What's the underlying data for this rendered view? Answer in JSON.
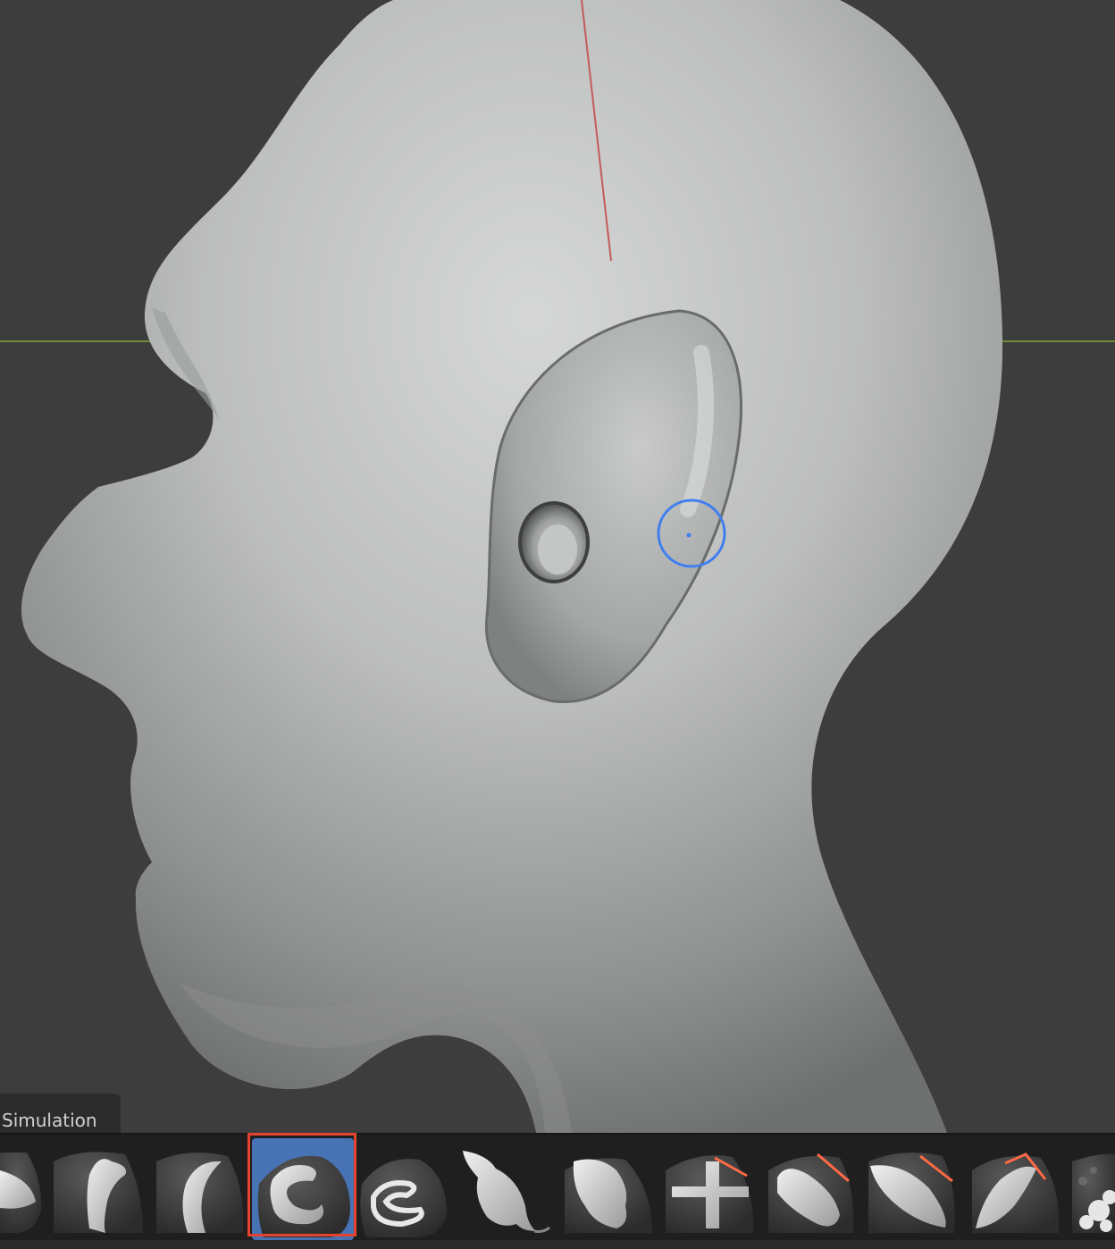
{
  "panel": {
    "tab_label": "Simulation"
  },
  "brushes": [
    {
      "name": "partial-brush",
      "active": false
    },
    {
      "name": "draw-brush",
      "active": false
    },
    {
      "name": "draw-sharp-brush",
      "active": false
    },
    {
      "name": "clay-brush",
      "active": true
    },
    {
      "name": "crease-brush",
      "active": false
    },
    {
      "name": "snake-hook-brush",
      "active": false
    },
    {
      "name": "blob-brush",
      "active": false
    },
    {
      "name": "pinch-brush",
      "active": false
    },
    {
      "name": "flatten-brush",
      "active": false
    },
    {
      "name": "scrape-brush",
      "active": false
    },
    {
      "name": "fill-brush",
      "active": false
    },
    {
      "name": "multires-brush",
      "active": false
    }
  ],
  "colors": {
    "viewport_bg": "#3d3d3d",
    "active_brush": "#4772b3",
    "highlight": "#e5432f",
    "cursor_ring": "#3f7ef0",
    "axis_x": "#c45b5b",
    "axis_y": "#6f8b3a"
  }
}
